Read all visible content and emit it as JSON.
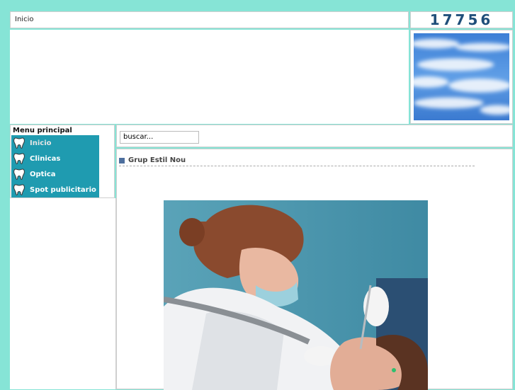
{
  "breadcrumb": {
    "label": "Inicio"
  },
  "counter": {
    "value": "17756"
  },
  "menu": {
    "title": "Menu principal",
    "items": [
      {
        "label": "Inicio",
        "icon": "tooth-icon"
      },
      {
        "label": "Clinicas",
        "icon": "tooth-icon"
      },
      {
        "label": "Optica",
        "icon": "tooth-icon"
      },
      {
        "label": "Spot publicitario",
        "icon": "tooth-icon"
      }
    ]
  },
  "search": {
    "value": "buscar..."
  },
  "content": {
    "title": "Grup Estil Nou"
  },
  "colors": {
    "page_background": "#86e4d6",
    "menu_background": "#1f9bb0",
    "counter_text": "#1f4e7a"
  }
}
